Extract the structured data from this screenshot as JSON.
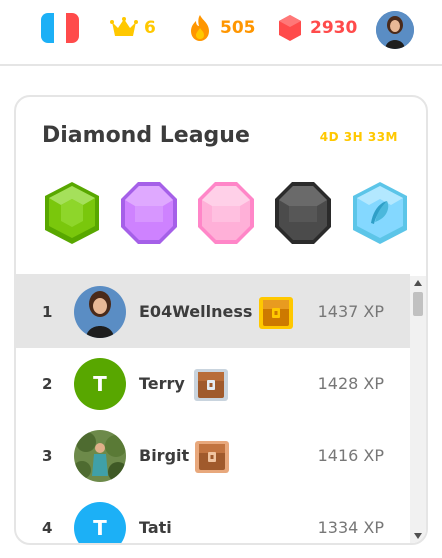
{
  "header": {
    "language": "French",
    "crowns": "6",
    "streak": "505",
    "gems": "2930",
    "colors": {
      "crown": "#ffc800",
      "streak": "#ff9600",
      "gems": "#ff4b4b"
    }
  },
  "league": {
    "title": "Diamond League",
    "timer": "4D 3H 33M",
    "badges": [
      {
        "icon": "emerald-league-badge-icon",
        "color": "#7ac70c"
      },
      {
        "icon": "amethyst-league-badge-icon",
        "color": "#ce82ff"
      },
      {
        "icon": "pearl-league-badge-icon",
        "color": "#ffb0d8"
      },
      {
        "icon": "obsidian-league-badge-icon",
        "color": "#4b4b4b"
      },
      {
        "icon": "diamond-league-badge-icon",
        "color": "#84d8ff"
      }
    ]
  },
  "leaderboard": {
    "rows": [
      {
        "rank": "1",
        "name": "E04Wellness",
        "xp": "1437 XP",
        "avatar": "photo",
        "chest": "gold",
        "highlighted": true
      },
      {
        "rank": "2",
        "name": "Terry",
        "initial": "T",
        "xp": "1428 XP",
        "avatar_color": "#58a700",
        "chest": "silver"
      },
      {
        "rank": "3",
        "name": "Birgit",
        "xp": "1416 XP",
        "avatar": "photo",
        "chest": "bronze"
      },
      {
        "rank": "4",
        "name": "Tati",
        "initial": "T",
        "xp": "1334 XP",
        "avatar_color": "#1cb0f6"
      }
    ]
  }
}
